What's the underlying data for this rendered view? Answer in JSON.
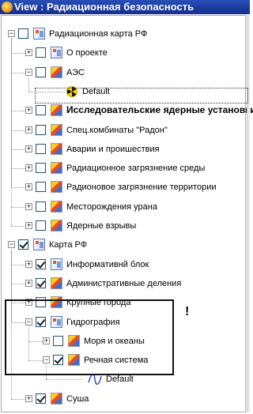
{
  "window": {
    "title": "View : Радиационная безопасность"
  },
  "tree": [
    {
      "label": "Радиационная карта РФ",
      "pm": "minus",
      "checked": false,
      "icon": "group-layer-icon",
      "level": 0
    },
    {
      "label": "О проекте",
      "pm": "plus",
      "checked": false,
      "icon": "group-layer-icon",
      "level": 1
    },
    {
      "label": "АЭС",
      "pm": "minus",
      "checked": false,
      "icon": "layer-icon",
      "level": 1
    },
    {
      "label": "Default",
      "pm": null,
      "checked": null,
      "icon": "radiation-symbol-icon",
      "level": 2
    },
    {
      "label": "Исследовательские ядерные установки",
      "pm": "plus",
      "checked": false,
      "icon": "layer-icon",
      "level": 1,
      "bold": true
    },
    {
      "label": "Спец.комбинаты \"Радон\"",
      "pm": "plus",
      "checked": false,
      "icon": "layer-icon",
      "level": 1
    },
    {
      "label": "Аварии и проишествия",
      "pm": "plus",
      "checked": false,
      "icon": "layer-icon",
      "level": 1
    },
    {
      "label": "Радиационное загрязнение среды",
      "pm": "plus",
      "checked": false,
      "icon": "layer-icon",
      "level": 1
    },
    {
      "label": "Радионовое загрязнение территории",
      "pm": "plus",
      "checked": false,
      "icon": "layer-icon",
      "level": 1
    },
    {
      "label": "Месторождения урана",
      "pm": "plus",
      "checked": false,
      "icon": "layer-icon",
      "level": 1
    },
    {
      "label": "Ядерные взрывы",
      "pm": "plus",
      "checked": false,
      "icon": "layer-icon",
      "level": 1
    },
    {
      "label": "Карта РФ",
      "pm": "minus",
      "checked": true,
      "icon": "group-layer-icon",
      "level": 0
    },
    {
      "label": "Информативнй блок",
      "pm": "plus",
      "checked": true,
      "icon": "group-layer-icon",
      "level": 1
    },
    {
      "label": "Административные деления",
      "pm": "plus",
      "checked": true,
      "icon": "layer-icon",
      "level": 1
    },
    {
      "label": "Крупные города",
      "pm": "plus",
      "checked": false,
      "icon": "layer-icon",
      "level": 1
    },
    {
      "label": "Гидрография",
      "pm": "minus",
      "checked": true,
      "icon": "group-layer-icon",
      "level": 1
    },
    {
      "label": "Моря и океаны",
      "pm": "plus",
      "checked": false,
      "icon": "layer-icon",
      "level": 2
    },
    {
      "label": "Речная система",
      "pm": "minus",
      "checked": true,
      "icon": "layer-icon",
      "level": 2
    },
    {
      "label": "Default",
      "pm": null,
      "checked": null,
      "icon": "line-symbol-icon",
      "level": 3
    },
    {
      "label": "Суша",
      "pm": "plus",
      "checked": true,
      "icon": "layer-icon",
      "level": 1
    }
  ],
  "annotation": {
    "mark": "!"
  },
  "colors": {
    "title_bar": "#1c3aa0",
    "frame": "#111111",
    "line_symbol": "#2b3bd6"
  }
}
